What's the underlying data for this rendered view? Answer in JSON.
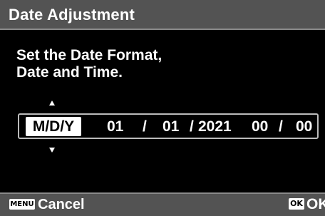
{
  "header": {
    "title": "Date Adjustment"
  },
  "instructions": {
    "line1": "Set the Date Format,",
    "line2": "Date and Time."
  },
  "date_row": {
    "format": "M/D/Y",
    "month": "01",
    "sep1": "/",
    "day": "01",
    "sep2": "/",
    "year": "2021",
    "hour": "00",
    "sep3": "/",
    "minute": "00"
  },
  "footer": {
    "menu_key": "MENU",
    "cancel_label": "Cancel",
    "ok_key": "OK",
    "ok_label": "OK"
  },
  "colors": {
    "bar_bg": "#535353",
    "screen_bg": "#000000",
    "highlight": "#ffffff"
  },
  "icons": {
    "up": "arrow-up-icon",
    "down": "arrow-down-icon"
  }
}
